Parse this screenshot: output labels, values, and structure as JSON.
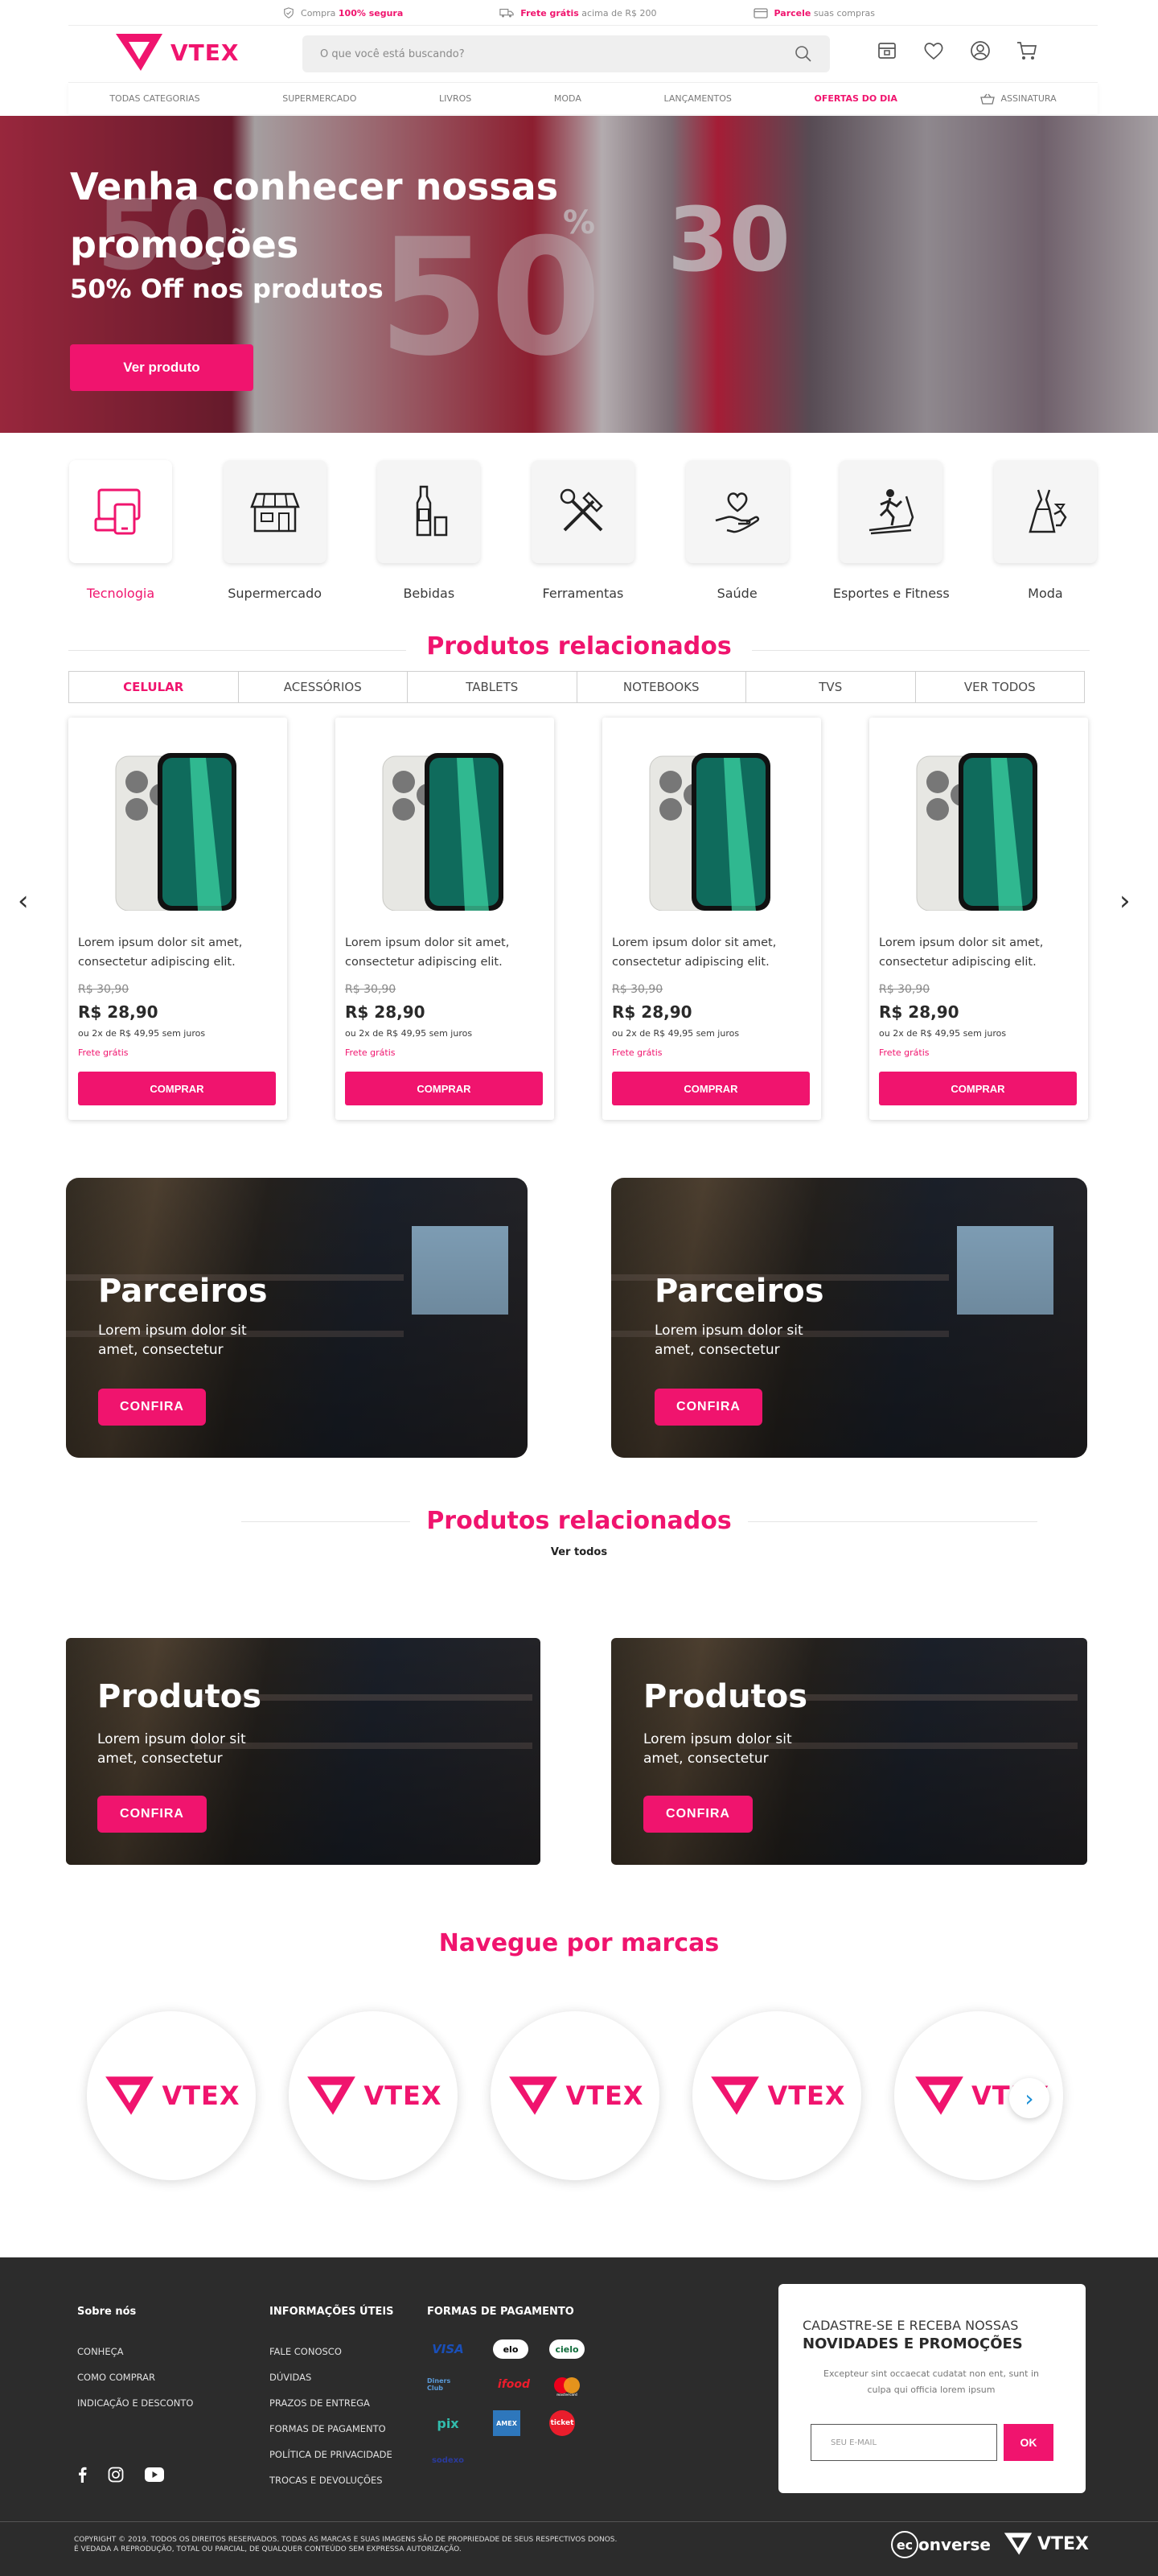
{
  "topbar": {
    "items": [
      {
        "pre": "Compra ",
        "bold": "100% segura",
        "post": ""
      },
      {
        "pre": "",
        "bold": "Frete grátis",
        "post": " acima de R$ 200"
      },
      {
        "pre": "",
        "bold": "Parcele",
        "post": " suas compras"
      }
    ]
  },
  "header": {
    "logo": "VTEX",
    "search_placeholder": "O que você está buscando?"
  },
  "nav": {
    "items": [
      "TODAS CATEGORIAS",
      "SUPERMERCADO",
      "LIVROS",
      "MODA",
      "LANÇAMENTOS",
      "OFERTAS DO DIA",
      "ASSINATURA"
    ],
    "active": "OFERTAS DO DIA"
  },
  "hero": {
    "title": "Venha conhecer nossas promoções",
    "subtitle": "50% Off nos produtos",
    "cta": "Ver produto"
  },
  "categories": [
    {
      "label": "Tecnologia",
      "icon": "devices-icon",
      "active": true
    },
    {
      "label": "Supermercado",
      "icon": "store-icon",
      "active": false
    },
    {
      "label": "Bebidas",
      "icon": "bottle-icon",
      "active": false
    },
    {
      "label": "Ferramentas",
      "icon": "tools-icon",
      "active": false
    },
    {
      "label": "Saúde",
      "icon": "heart-hand-icon",
      "active": false
    },
    {
      "label": "Esportes e Fitness",
      "icon": "treadmill-icon",
      "active": false
    },
    {
      "label": "Moda",
      "icon": "dress-icon",
      "active": false
    }
  ],
  "related": {
    "title": "Produtos relacionados",
    "tabs": [
      "CELULAR",
      "ACESSÓRIOS",
      "TABLETS",
      "NOTEBOOKS",
      "TVS",
      "VER TODOS"
    ],
    "active_tab": "CELULAR",
    "products": [
      {
        "name": "Lorem ipsum dolor sit amet, consectetur adipiscing elit.",
        "old_price": "R$ 30,90",
        "price": "R$ 28,90",
        "installments": "ou 2x de R$ 49,95 sem juros",
        "shipping": "Frete grátis",
        "buy": "COMPRAR"
      },
      {
        "name": "Lorem ipsum dolor sit amet, consectetur adipiscing elit.",
        "old_price": "R$ 30,90",
        "price": "R$ 28,90",
        "installments": "ou 2x de R$ 49,95 sem juros",
        "shipping": "Frete grátis",
        "buy": "COMPRAR"
      },
      {
        "name": "Lorem ipsum dolor sit amet, consectetur adipiscing elit.",
        "old_price": "R$ 30,90",
        "price": "R$ 28,90",
        "installments": "ou 2x de R$ 49,95 sem juros",
        "shipping": "Frete grátis",
        "buy": "COMPRAR"
      },
      {
        "name": "Lorem ipsum dolor sit amet, consectetur adipiscing elit.",
        "old_price": "R$ 30,90",
        "price": "R$ 28,90",
        "installments": "ou 2x de R$ 49,95 sem juros",
        "shipping": "Frete grátis",
        "buy": "COMPRAR"
      }
    ]
  },
  "partners": [
    {
      "title": "Parceiros",
      "text": "Lorem ipsum dolor sit amet, consectetur",
      "cta": "CONFIRA"
    },
    {
      "title": "Parceiros",
      "text": "Lorem ipsum dolor sit amet, consectetur",
      "cta": "CONFIRA"
    }
  ],
  "related2": {
    "title": "Produtos relacionados",
    "link": "Ver todos"
  },
  "products_banners": [
    {
      "title": "Produtos",
      "text": "Lorem ipsum dolor sit amet, consectetur",
      "cta": "CONFIRA"
    },
    {
      "title": "Produtos",
      "text": "Lorem ipsum dolor sit amet, consectetur",
      "cta": "CONFIRA"
    }
  ],
  "brands": {
    "title": "Navegue por marcas",
    "items": [
      "VTEX",
      "VTEX",
      "VTEX",
      "VTEX",
      "VTEX"
    ]
  },
  "footer": {
    "about": {
      "title": "Sobre nós",
      "links": [
        "CONHEÇA",
        "COMO COMPRAR",
        "INDICAÇÃO E DESCONTO"
      ]
    },
    "info": {
      "title": "INFORMAÇÕES ÚTEIS",
      "links": [
        "FALE CONOSCO",
        "DÚVIDAS",
        "PRAZOS DE ENTREGA",
        "FORMAS DE PAGAMENTO",
        "POLÍTICA DE PRIVACIDADE",
        "TROCAS E DEVOLUÇÕES"
      ]
    },
    "payment": {
      "title": "FORMAS DE PAGAMENTO",
      "methods": [
        "VISA",
        "elo",
        "cielo",
        "Diners Club",
        "ifood",
        "mastercard",
        "pix",
        "AMEX",
        "ticket",
        "sodexo"
      ]
    },
    "newsletter": {
      "line1": "CADASTRE-SE E RECEBA NOSSAS",
      "line2": "NOVIDADES E PROMOÇÕES",
      "text": "Excepteur sint occaecat cudatat non ent, sunt in culpa qui officia lorem ipsum",
      "placeholder": "SEU E-MAIL",
      "button": "OK"
    },
    "copyright1": "COPYRIGHT © 2019. TODOS OS DIREITOS RESERVADOS. TODAS AS MARCAS E SUAS IMAGENS SÃO DE PROPRIEDADE DE SEUS RESPECTIVOS DONOS.",
    "copyright2": "É VEDADA A REPRODUÇÃO, TOTAL OU PARCIAL, DE QUALQUER CONTEÚDO SEM EXPRESSA AUTORIZAÇÃO.",
    "partner_logo_pre": "ec",
    "partner_logo_post": "onverse",
    "vtex_logo": "VTEX"
  },
  "colors": {
    "accent": "#f0146e",
    "footer_bg": "#2c2c2c"
  }
}
